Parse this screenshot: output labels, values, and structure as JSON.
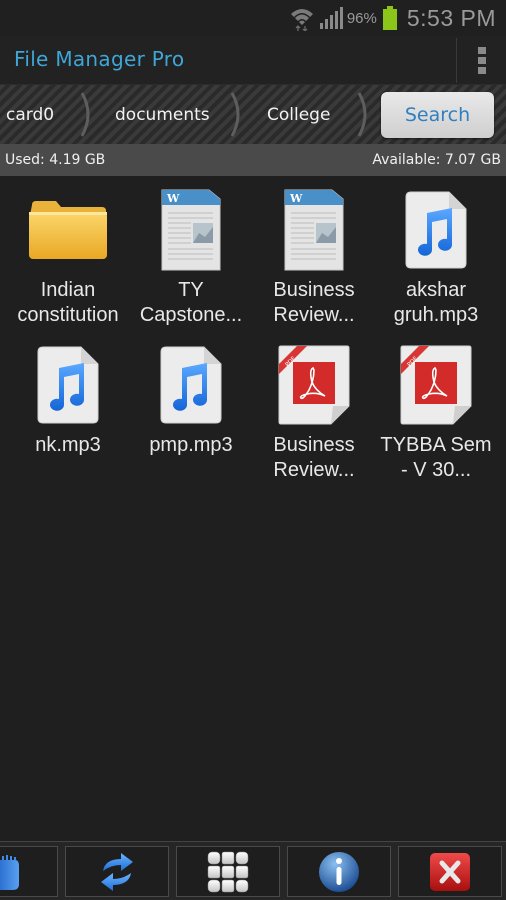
{
  "status_bar": {
    "wifi_icon": "wifi-icon",
    "signal_icon": "signal-icon",
    "battery_percent": "96%",
    "battery_icon": "battery-icon",
    "battery_color": "#8cc51a",
    "time": "5:53 PM"
  },
  "action_bar": {
    "title": "File Manager Pro",
    "title_color": "#3fa6d8",
    "overflow_icon": "overflow-menu-icon"
  },
  "breadcrumb": {
    "items": [
      {
        "label": "card0"
      },
      {
        "label": "documents"
      },
      {
        "label": "College"
      }
    ],
    "search_label": "Search"
  },
  "storage": {
    "used": "Used: 4.19 GB",
    "available": "Available: 7.07 GB"
  },
  "files": [
    {
      "name": "Indian\nconstitution",
      "type": "folder"
    },
    {
      "name": "TY\nCapstone...",
      "type": "word"
    },
    {
      "name": "Business\nReview...",
      "type": "word"
    },
    {
      "name": "akshar\ngruh.mp3",
      "type": "audio"
    },
    {
      "name": "nk.mp3",
      "type": "audio"
    },
    {
      "name": "pmp.mp3",
      "type": "audio"
    },
    {
      "name": "Business\nReview...",
      "type": "pdf"
    },
    {
      "name": "TYBBA Sem\n- V 30...",
      "type": "pdf"
    }
  ],
  "toolbar": {
    "buttons": [
      {
        "icon": "partial-multiselect-icon"
      },
      {
        "icon": "refresh-icon"
      },
      {
        "icon": "grid-view-icon"
      },
      {
        "icon": "info-icon"
      },
      {
        "icon": "close-icon"
      }
    ]
  }
}
